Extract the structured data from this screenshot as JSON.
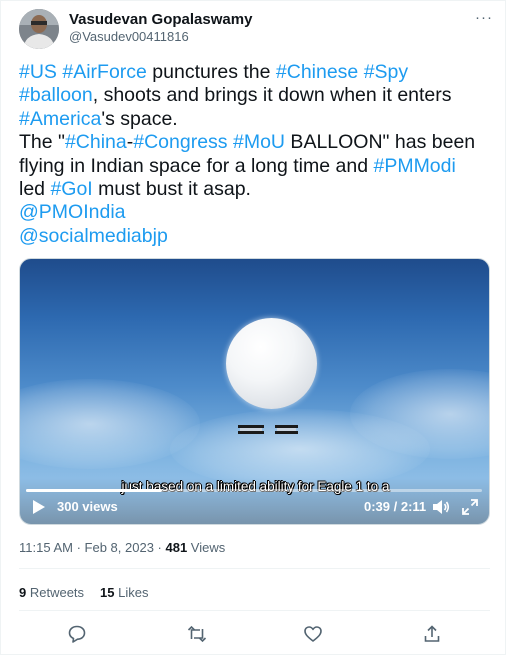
{
  "user": {
    "name": "Vasudevan Gopalaswamy",
    "handle": "@Vasudev00411816"
  },
  "more_label": "···",
  "tweet": {
    "lines": [
      [
        {
          "t": "#US",
          "link": true
        },
        {
          "t": " ",
          "link": false
        },
        {
          "t": "#AirForce",
          "link": true
        },
        {
          "t": " punctures the ",
          "link": false
        },
        {
          "t": "#Chinese",
          "link": true
        },
        {
          "t": " ",
          "link": false
        },
        {
          "t": "#Spy",
          "link": true
        }
      ],
      [
        {
          "t": "#balloon",
          "link": true
        },
        {
          "t": ", shoots and brings it down when it enters",
          "link": false
        }
      ],
      [
        {
          "t": "#America",
          "link": true
        },
        {
          "t": "'s space.",
          "link": false
        }
      ],
      [
        {
          "t": "The \"",
          "link": false
        },
        {
          "t": "#China",
          "link": true
        },
        {
          "t": "-",
          "link": false
        },
        {
          "t": "#Congress",
          "link": true
        },
        {
          "t": " ",
          "link": false
        },
        {
          "t": "#MoU",
          "link": true
        },
        {
          "t": " BALLOON\" has been",
          "link": false
        }
      ],
      [
        {
          "t": "flying in Indian space for a long time and ",
          "link": false
        },
        {
          "t": "#PMModi",
          "link": true
        }
      ],
      [
        {
          "t": "led ",
          "link": false
        },
        {
          "t": "#GoI",
          "link": true
        },
        {
          "t": " must bust it asap.",
          "link": false
        }
      ],
      [
        {
          "t": "@PMOIndia",
          "link": true
        }
      ],
      [
        {
          "t": "@socialmediabjp",
          "link": true
        }
      ]
    ]
  },
  "video": {
    "caption": "just based on a limited ability for Eagle 1 to a",
    "views": "300 views",
    "time": "0:39 / 2:11",
    "progress": 0.298
  },
  "meta": {
    "time": "11:15 AM",
    "sep1": " · ",
    "date": "Feb 8, 2023",
    "sep2": " · ",
    "views_count": "481",
    "views_label": " Views"
  },
  "stats": {
    "retweets_count": "9",
    "retweets_label": " Retweets",
    "likes_count": "15",
    "likes_label": " Likes"
  },
  "colors": {
    "link": "#1d9bf0",
    "text": "#0f1419",
    "muted": "#536471"
  }
}
